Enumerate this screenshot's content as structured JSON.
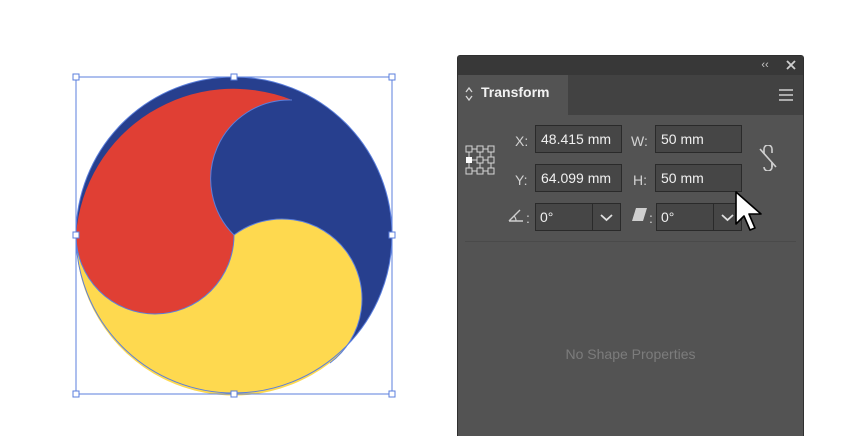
{
  "panel": {
    "tab_label": "Transform",
    "x_label": "X:",
    "x_value": "48.415 mm",
    "y_label": "Y:",
    "y_value": "64.099 mm",
    "w_label": "W:",
    "w_value": "50 mm",
    "h_label": "H:",
    "h_value": "50 mm",
    "angle_label": ":",
    "angle_value": "0°",
    "shear_label": ":",
    "shear_value": "0°",
    "empty_message": "No Shape Properties"
  },
  "artwork": {
    "colors": {
      "red": "#E03F34",
      "blue": "#273F8E",
      "yellow": "#FED94F",
      "selection": "#5B7FDD"
    }
  },
  "icons": [
    "collapse-icon",
    "close-icon",
    "updown-arrows-icon",
    "menu-icon",
    "reference-point-icon",
    "unlink-icon",
    "rotate-angle-icon",
    "shear-icon",
    "chevron-down-icon",
    "mouse-cursor-icon"
  ]
}
